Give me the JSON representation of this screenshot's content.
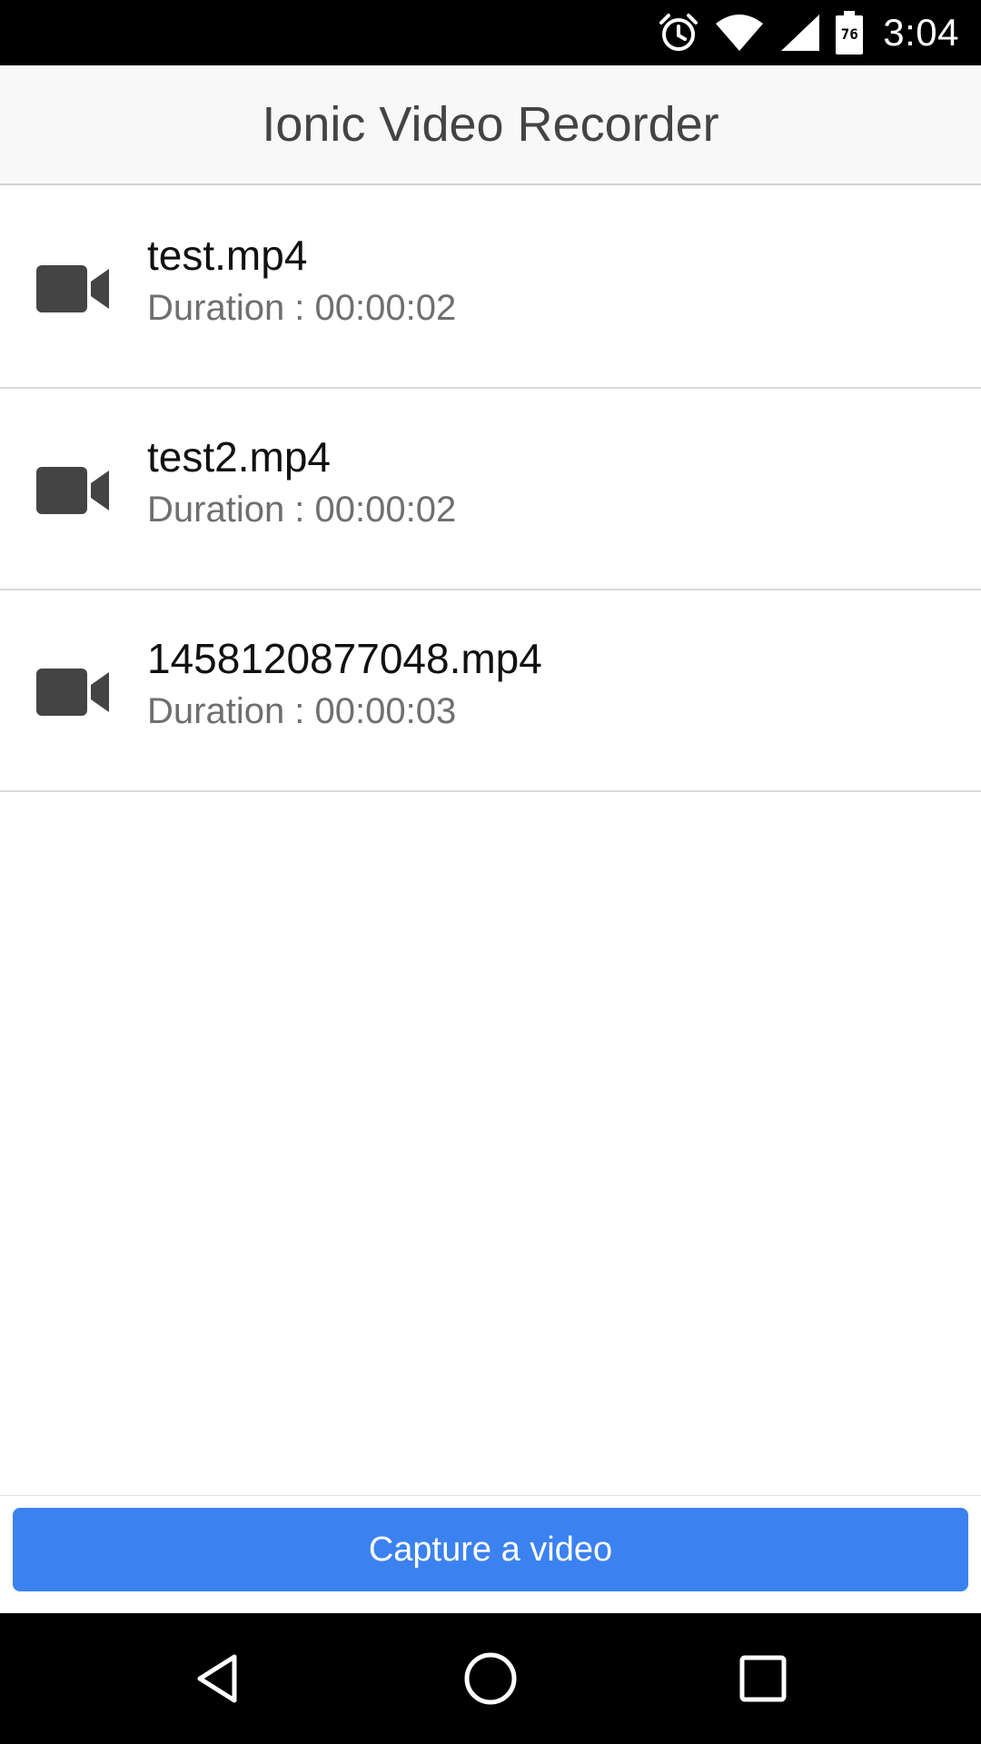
{
  "status_bar": {
    "time": "3:04",
    "battery_level": "76",
    "icons": [
      "alarm-icon",
      "wifi-icon",
      "cell-signal-icon",
      "battery-icon"
    ]
  },
  "header": {
    "title": "Ionic Video Recorder"
  },
  "videos": [
    {
      "name": "test.mp4",
      "duration": "Duration : 00:00:02",
      "icon": "video-camera-icon"
    },
    {
      "name": "test2.mp4",
      "duration": "Duration : 00:00:02",
      "icon": "video-camera-icon"
    },
    {
      "name": "1458120877048.mp4",
      "duration": "Duration : 00:00:03",
      "icon": "video-camera-icon"
    }
  ],
  "footer": {
    "capture_label": "Capture a video"
  },
  "nav_bar": {
    "buttons": [
      "back-icon",
      "home-icon",
      "recents-icon"
    ]
  },
  "colors": {
    "primary": "#3b82f0",
    "header_bg": "#f8f8f8",
    "icon": "#444444"
  }
}
